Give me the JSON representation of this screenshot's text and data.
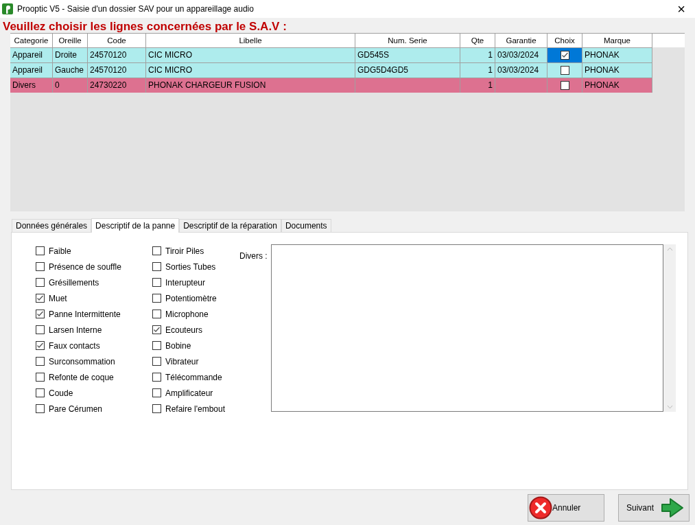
{
  "window": {
    "title": "Prooptic V5 - Saisie d'un dossier SAV pour un appareillage audio",
    "close": "×"
  },
  "heading": "Veuillez choisir les lignes concernées par le S.A.V :",
  "table": {
    "columns": [
      "Categorie",
      "Oreille",
      "Code",
      "Libelle",
      "Num. Serie",
      "Qte",
      "Garantie",
      "Choix",
      "Marque"
    ],
    "rows": [
      {
        "cells": [
          "Appareil",
          "Droite",
          "24570120",
          "CIC MICRO",
          "GD545S",
          "1",
          "03/03/2024"
        ],
        "checked": true,
        "selected": true,
        "marque": "PHONAK",
        "color": "#aeeced"
      },
      {
        "cells": [
          "Appareil",
          "Gauche",
          "24570120",
          "CIC MICRO",
          "GDG5D4GD5",
          "1",
          "03/03/2024"
        ],
        "checked": false,
        "selected": false,
        "marque": "PHONAK",
        "color": "#aeeced"
      },
      {
        "cells": [
          "Divers",
          "0",
          "24730220",
          "PHONAK CHARGEUR FUSION",
          "",
          "1",
          ""
        ],
        "checked": false,
        "selected": false,
        "marque": "PHONAK",
        "color": "#dd7190"
      }
    ]
  },
  "tabs": [
    {
      "label": "Données générales",
      "selected": false
    },
    {
      "label": "Descriptif de la panne",
      "selected": true
    },
    {
      "label": "Descriptif de la réparation",
      "selected": false
    },
    {
      "label": "Documents",
      "selected": false
    }
  ],
  "checkbox_columns": [
    [
      {
        "label": "Faible",
        "checked": false
      },
      {
        "label": "Présence de souffle",
        "checked": false
      },
      {
        "label": "Grésillements",
        "checked": false
      },
      {
        "label": "Muet",
        "checked": true
      },
      {
        "label": "Panne Intermittente",
        "checked": true
      },
      {
        "label": "Larsen Interne",
        "checked": false
      },
      {
        "label": "Faux contacts",
        "checked": true
      },
      {
        "label": "Surconsommation",
        "checked": false
      },
      {
        "label": "Refonte de coque",
        "checked": false
      },
      {
        "label": "Coude",
        "checked": false
      },
      {
        "label": "Pare Cérumen",
        "checked": false
      }
    ],
    [
      {
        "label": "Tiroir Piles",
        "checked": false
      },
      {
        "label": "Sorties Tubes",
        "checked": false
      },
      {
        "label": "Interupteur",
        "checked": false
      },
      {
        "label": "Potentiomètre",
        "checked": false
      },
      {
        "label": "Microphone",
        "checked": false
      },
      {
        "label": "Ecouteurs",
        "checked": true
      },
      {
        "label": "Bobine",
        "checked": false
      },
      {
        "label": "Vibrateur",
        "checked": false
      },
      {
        "label": "Télécommande",
        "checked": false
      },
      {
        "label": "Amplificateur",
        "checked": false
      },
      {
        "label": "Refaire l'embout",
        "checked": false
      }
    ]
  ],
  "divers": {
    "label": "Divers :"
  },
  "buttons": [
    {
      "label": "Annuler",
      "kind": "cancel"
    },
    {
      "label": "Suivant",
      "kind": "next"
    }
  ]
}
